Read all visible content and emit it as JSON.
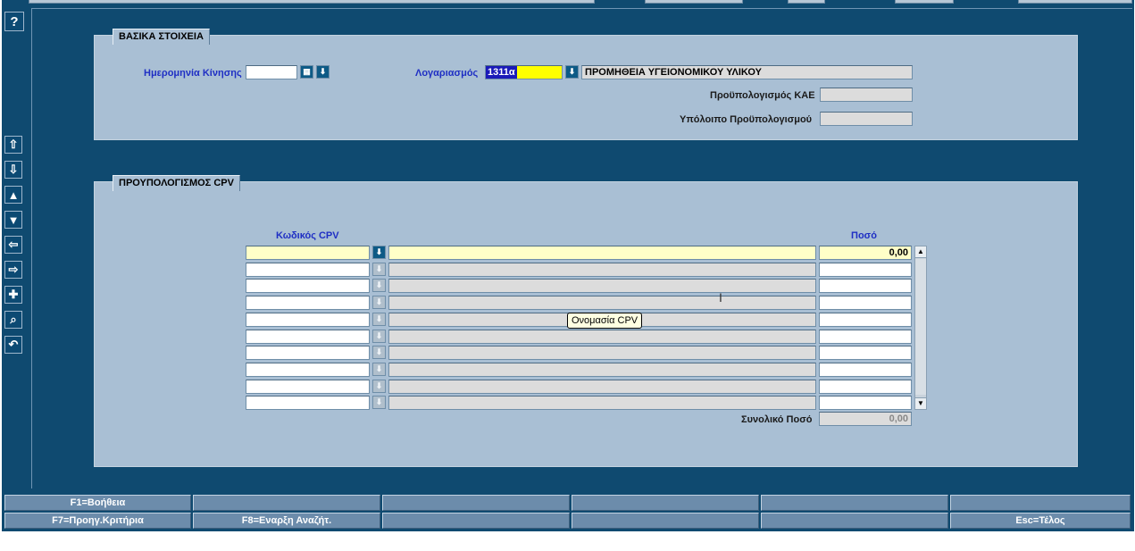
{
  "help_button": "?",
  "section1": {
    "title": "ΒΑΣΙΚΑ ΣΤΟΙΧΕΙΑ",
    "date_label": "Ημερομηνία Κίνησης",
    "date_value": "",
    "account_label": "Λογαριασμός",
    "account_code": "1311α",
    "account_name": "ΠΡΟΜΗΘΕΙΑ ΥΓΕΙΟΝΟΜΙΚΟΥ ΥΛΙΚΟΥ",
    "budget_label": "Προϋπολογισμός ΚΑΕ",
    "budget_value": "",
    "remaining_label": "Υπόλοιπο Προϋπολογισμού",
    "remaining_value": ""
  },
  "section2": {
    "title": "ΠΡΟΥΠΟΛΟΓΙΣΜΟΣ CPV",
    "col_code": "Κωδικός CPV",
    "col_amount": "Ποσό",
    "rows": [
      {
        "code": "",
        "name": "",
        "amount": "0,00"
      },
      {
        "code": "",
        "name": "",
        "amount": ""
      },
      {
        "code": "",
        "name": "",
        "amount": ""
      },
      {
        "code": "",
        "name": "",
        "amount": ""
      },
      {
        "code": "",
        "name": "",
        "amount": ""
      },
      {
        "code": "",
        "name": "",
        "amount": ""
      },
      {
        "code": "",
        "name": "",
        "amount": ""
      },
      {
        "code": "",
        "name": "",
        "amount": ""
      },
      {
        "code": "",
        "name": "",
        "amount": ""
      },
      {
        "code": "",
        "name": "",
        "amount": ""
      }
    ],
    "total_label": "Συνολικό Ποσό",
    "total_value": "0,00",
    "tooltip": "Ονομασία CPV"
  },
  "function_keys": {
    "row1": [
      "F1=Βοήθεια",
      "",
      "",
      "",
      "",
      ""
    ],
    "row2": [
      "F7=Προηγ.Κριτήρια",
      "F8=Εναρξη Αναζήτ.",
      "",
      "",
      "",
      "Esc=Τέλος"
    ]
  },
  "side_toolbar": [
    "first-record-icon",
    "last-record-icon",
    "previous-record-icon",
    "next-record-icon",
    "previous-block-icon",
    "next-block-icon",
    "insert-record-icon",
    "search-icon",
    "undo-icon"
  ],
  "colors": {
    "background": "#0f4a70",
    "panel": "#a9bfd4",
    "label_blue": "#1f2fc4",
    "highlight_yellow": "#ffff00",
    "selection_blue": "#1a1ab8"
  }
}
